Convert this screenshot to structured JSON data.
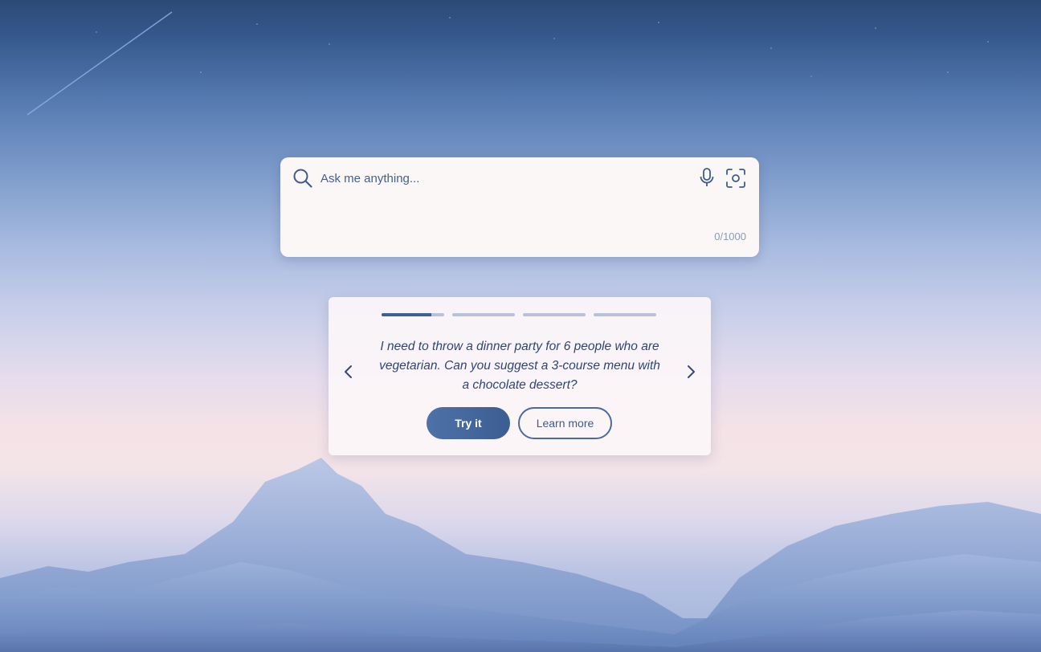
{
  "search": {
    "placeholder": "Ask me anything...",
    "value": "",
    "counter": "0/1000",
    "icons": [
      "search-icon",
      "microphone-icon",
      "visual-search-icon"
    ]
  },
  "suggestion_card": {
    "prompt": "I need to throw a dinner party for 6 people who are vegetarian. Can you suggest a 3-course menu with a chocolate dessert?",
    "progress": {
      "total_slides": 4,
      "current_slide": 1,
      "current_slide_progress": 0.8
    },
    "try_label": "Try it",
    "learn_label": "Learn more",
    "icons": [
      "chevron-left-icon",
      "chevron-right-icon"
    ]
  },
  "colors": {
    "accent": "#3e5f93",
    "text": "#2d4676",
    "card_bg": "#fcf7f7"
  }
}
